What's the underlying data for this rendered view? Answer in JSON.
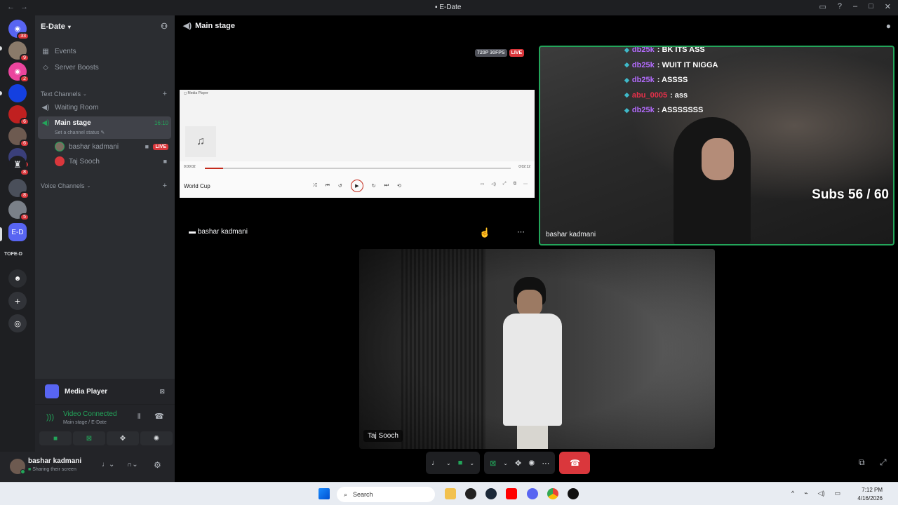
{
  "window": {
    "title": "E-Date"
  },
  "guilds": {
    "discord_badge": "33",
    "server_badges": [
      "9",
      "2",
      "6",
      "6",
      "2",
      "8",
      "8",
      "5"
    ],
    "label": "TOFE-D",
    "selected_abbr": "E-D"
  },
  "server": {
    "name": "E-Date",
    "top_items": [
      {
        "label": "Events",
        "icon": "calendar-icon"
      },
      {
        "label": "Server Boosts",
        "icon": "boost-icon"
      }
    ],
    "text_category": "Text Channels",
    "channels": [
      {
        "label": "Waiting Room"
      }
    ],
    "active_channel": {
      "label": "Main stage",
      "time": "16:10",
      "status_placeholder": "Set a channel status"
    },
    "members": [
      {
        "name": "bashar kadmani",
        "live": "LIVE"
      },
      {
        "name": "Taj Sooch"
      }
    ],
    "voice_category": "Voice Channels"
  },
  "media_panel": {
    "label": "Media Player"
  },
  "voice_panel": {
    "status": "Video Connected",
    "location": "Main stage / E-Date"
  },
  "user_panel": {
    "name": "bashar kadmani",
    "status": "Sharing their screen"
  },
  "stage": {
    "title": "Main stage",
    "quality": "720P 30FPS",
    "live": "LIVE",
    "media_player": {
      "app_title": "Media Player",
      "track": "World Cup",
      "time_start": "0:00:02",
      "time_end": "0:02:12",
      "progress": 0.06
    },
    "tile1_name": "bashar kadmani",
    "tile2": {
      "name": "bashar kadmani",
      "chat": [
        {
          "user": "db25k",
          "color": "#b46cff",
          "msg": ": BK ITS ASS"
        },
        {
          "user": "db25k",
          "color": "#b46cff",
          "msg": ": WUIT IT NIGGA"
        },
        {
          "user": "db25k",
          "color": "#b46cff",
          "msg": ": ASSSS"
        },
        {
          "user": "abu_0005",
          "color": "#e8304a",
          "msg": ": ass"
        },
        {
          "user": "db25k",
          "color": "#b46cff",
          "msg": ": ASSSSSSS"
        }
      ],
      "subs": "Subs 56 / 60"
    },
    "tile3_name": "Taj Sooch"
  },
  "taskbar": {
    "search": "Search",
    "time": "7:12 PM",
    "date": "4/16/2026"
  },
  "colors": {
    "accent_green": "#23a55a",
    "danger_red": "#da373c",
    "bg_sidebar": "#2b2d31",
    "bg_dark": "#1e1f22"
  }
}
